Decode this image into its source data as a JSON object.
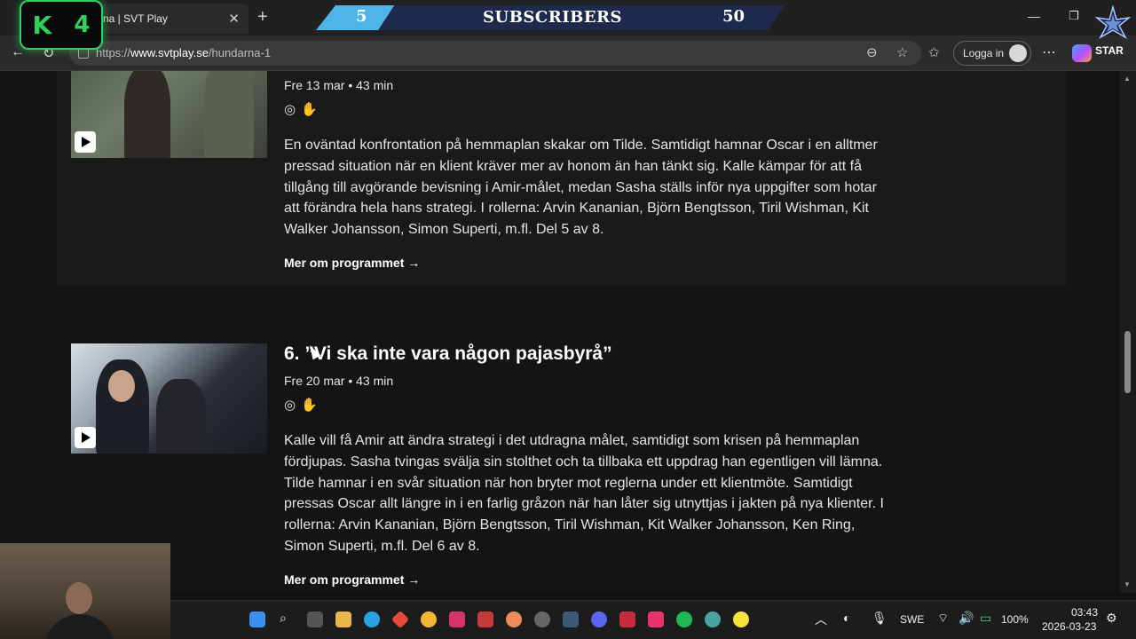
{
  "browser": {
    "tab_title": "na | SVT Play",
    "url_scheme": "https://",
    "url_host": "www.svtplay.se",
    "url_path": "/hundarna-1",
    "login_label": "Logga in"
  },
  "overlay": {
    "k_letter": "K",
    "k_count": "4",
    "subscribers_left": "5",
    "subscribers_title": "SUBSCRIBERS",
    "subscribers_right": "50",
    "star_text": "STAR"
  },
  "episodes": [
    {
      "meta": "Fre 13 mar • 43 min",
      "description": "En oväntad konfrontation på hemmaplan skakar om Tilde. Samtidigt hamnar Oscar i en alltmer pressad situation när en klient kräver mer av honom än han tänkt sig. Kalle kämpar för att få tillgång till avgörande bevisning i Amir-målet, medan Sasha ställs inför nya uppgifter som hotar att förändra hela hans strategi. I rollerna: Arvin Kananian, Björn Bengtsson, Tiril Wishman, Kit Walker Johansson, Simon Superti, m.fl. Del 5 av 8.",
      "more_label": "Mer om programmet →"
    },
    {
      "title": "6. ”Vi ska inte vara någon pajasbyrå”",
      "meta": "Fre 20 mar • 43 min",
      "description": "Kalle vill få Amir att ändra strategi i det utdragna målet, samtidigt som krisen på hemmaplan fördjupas. Sasha tvingas svälja sin stolthet och ta tillbaka ett uppdrag han egentligen vill lämna. Tilde hamnar i en svår situation när hon bryter mot reglerna under ett klientmöte. Samtidigt pressas Oscar allt längre in i en farlig gråzon när han låter sig utnyttjas i jakten på nya klienter. I rollerna: Arvin Kananian, Björn Bengtsson, Tiril Wishman, Kit Walker Johansson, Ken Ring, Simon Superti, m.fl. Del 6 av 8.",
      "more_label": "Mer om programmet →"
    }
  ],
  "taskbar": {
    "language": "SWE",
    "battery": "100%",
    "time": "03:43",
    "date": "2026-03-23"
  }
}
